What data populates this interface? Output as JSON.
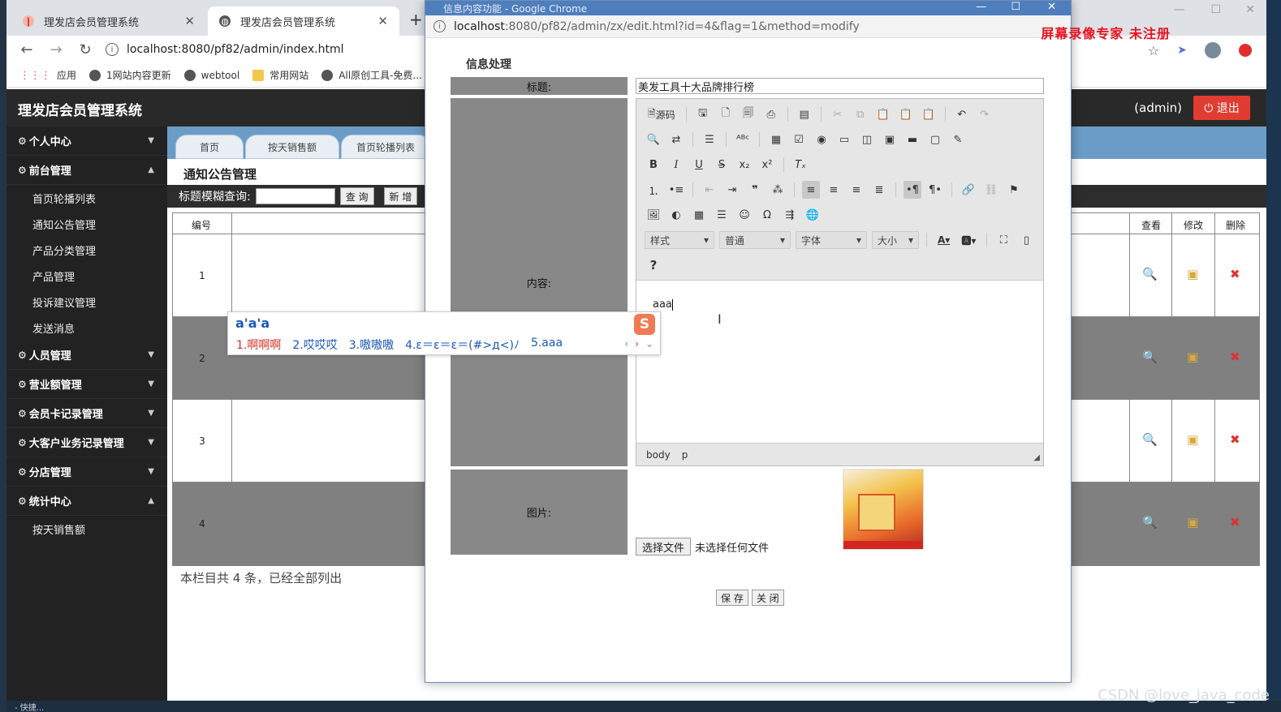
{
  "watermark": "屏幕录像专家  未注册",
  "footer_watermark": "CSDN @love_java_code",
  "bottom_task_text": "- 快捷...",
  "browser": {
    "tabs": [
      {
        "title": "理发店会员管理系统"
      },
      {
        "title": "理发店会员管理系统"
      }
    ],
    "close_glyph": "✕",
    "new_tab_glyph": "+",
    "back_glyph": "←",
    "forward_glyph": "→",
    "reload_glyph": "↻",
    "url": "localhost:8080/pf82/admin/index.html",
    "bookmarks": [
      "应用",
      "1网站内容更新",
      "webtool",
      "常用网站",
      "All原创工具-免费..."
    ]
  },
  "app": {
    "title": "理发店会员管理系统",
    "user": "(admin)",
    "logout": "⏻ 退出",
    "menu": [
      {
        "label": "个人中心",
        "expanded": false,
        "items": []
      },
      {
        "label": "前台管理",
        "expanded": true,
        "items": [
          "首页轮播列表",
          "通知公告管理",
          "产品分类管理",
          "产品管理",
          "投诉建议管理",
          "发送消息"
        ]
      },
      {
        "label": "人员管理",
        "expanded": false,
        "items": []
      },
      {
        "label": "营业额管理",
        "expanded": false,
        "items": []
      },
      {
        "label": "会员卡记录管理",
        "expanded": false,
        "items": []
      },
      {
        "label": "大客户业务记录管理",
        "expanded": false,
        "items": []
      },
      {
        "label": "分店管理",
        "expanded": false,
        "items": []
      },
      {
        "label": "统计中心",
        "expanded": true,
        "items": [
          "按天销售额"
        ]
      }
    ],
    "nav_tabs": [
      "首页",
      "按天销售额",
      "首页轮播列表"
    ],
    "section_title": "通知公告管理",
    "search_label": "标题模糊查询:",
    "search_button": "查 询",
    "add_button": "新 增",
    "table_headers": {
      "id": "编号",
      "view": "查看",
      "edit": "修改",
      "delete": "删除"
    },
    "rows": [
      "1",
      "2",
      "3",
      "4"
    ],
    "footer": "本栏目共 4 条，已经全部列出"
  },
  "popup": {
    "window_title": "信息内容功能 - Google Chrome",
    "url_host": "localhost",
    "url_rest": ":8080/pf82/admin/zx/edit.html?id=4&flag=1&method=modify",
    "heading": "信息处理",
    "labels": {
      "title": "标题:",
      "content": "内容:",
      "image": "图片:"
    },
    "title_value": "美发工具十大品牌排行榜",
    "toolbar": {
      "source": "源码",
      "combos": [
        "样式",
        "普通",
        "字体",
        "大小"
      ],
      "help": "?"
    },
    "editor_text": "aaa",
    "path_items": [
      "body",
      "p"
    ],
    "ime": {
      "input": "a'a'a",
      "candidates": [
        "1.啊啊啊",
        "2.哎哎哎",
        "3.嗷嗷嗷",
        "4.ε＝ε＝ε＝(#>д<)ﾉ",
        "5.aaa"
      ],
      "logo": "S"
    },
    "file_button": "选择文件",
    "file_status": "未选择任何文件",
    "save": "保 存",
    "close": "关 闭"
  }
}
